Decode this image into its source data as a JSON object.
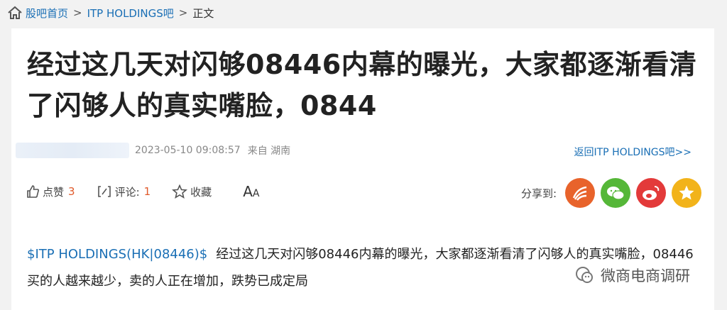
{
  "breadcrumb": {
    "home": "股吧首页",
    "sep": ">",
    "forum": "ITP HOLDINGS吧",
    "current": "正文"
  },
  "post": {
    "title": "经过这几天对闪够08446内幕的曝光，大家都逐渐看清了闪够人的真实嘴脸，0844",
    "datetime": "2023-05-10 09:08:57",
    "from_label": "来自 湖南",
    "back_link": "返回ITP HOLDINGS吧>>",
    "stock_tag": "$ITP HOLDINGS(HK|08446)$",
    "body": "经过这几天对闪够08446内幕的曝光，大家都逐渐看清了闪够人的真实嘴脸，08446买的人越来越少，卖的人正在增加，跌势已成定局"
  },
  "actions": {
    "like_label": "点赞",
    "like_count": "3",
    "comment_label": "评论:",
    "comment_count": "1",
    "fav_label": "收藏",
    "font_big": "A",
    "font_small": "A"
  },
  "share": {
    "label": "分享到:",
    "targets": [
      {
        "icon": "feed-icon",
        "color": "#e8632b"
      },
      {
        "icon": "wechat-icon",
        "color": "#55b738"
      },
      {
        "icon": "weibo-icon",
        "color": "#e33a3a"
      },
      {
        "icon": "qzone-icon",
        "color": "#f2b31a"
      }
    ]
  },
  "watermark": "微商电商调研"
}
